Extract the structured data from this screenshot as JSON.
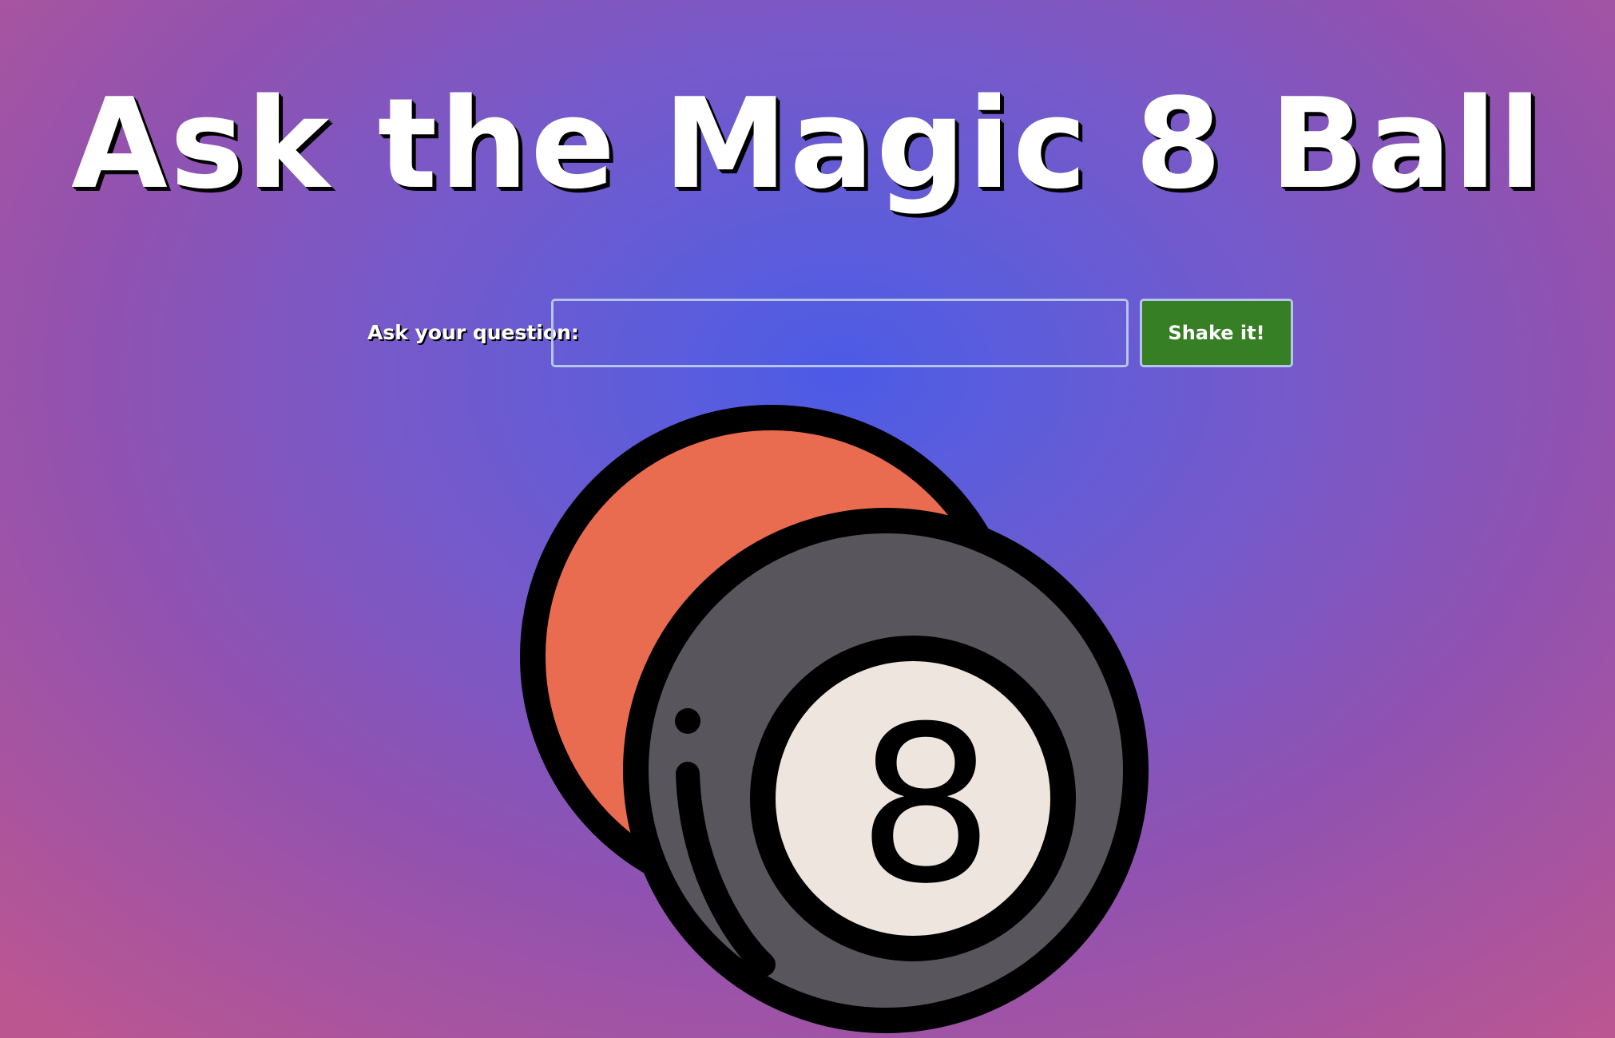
{
  "page": {
    "title": "Ask the Magic 8 Ball"
  },
  "form": {
    "label": "Ask your question:",
    "input_value": "",
    "input_placeholder": "",
    "button_label": "Shake it!"
  },
  "illustration": {
    "icon": "magic-8-ball-icon",
    "number_on_ball": "8"
  },
  "colors": {
    "background_center": "#4c5ae6",
    "background_edge": "#bd5690",
    "button_background": "#367f24",
    "input_border": "#b6c5ec",
    "title_text": "#ffffff",
    "red_ball": "#e96b50",
    "eight_ball": "#58565c",
    "eight_ball_window": "#ede5de",
    "outline": "#000000"
  }
}
